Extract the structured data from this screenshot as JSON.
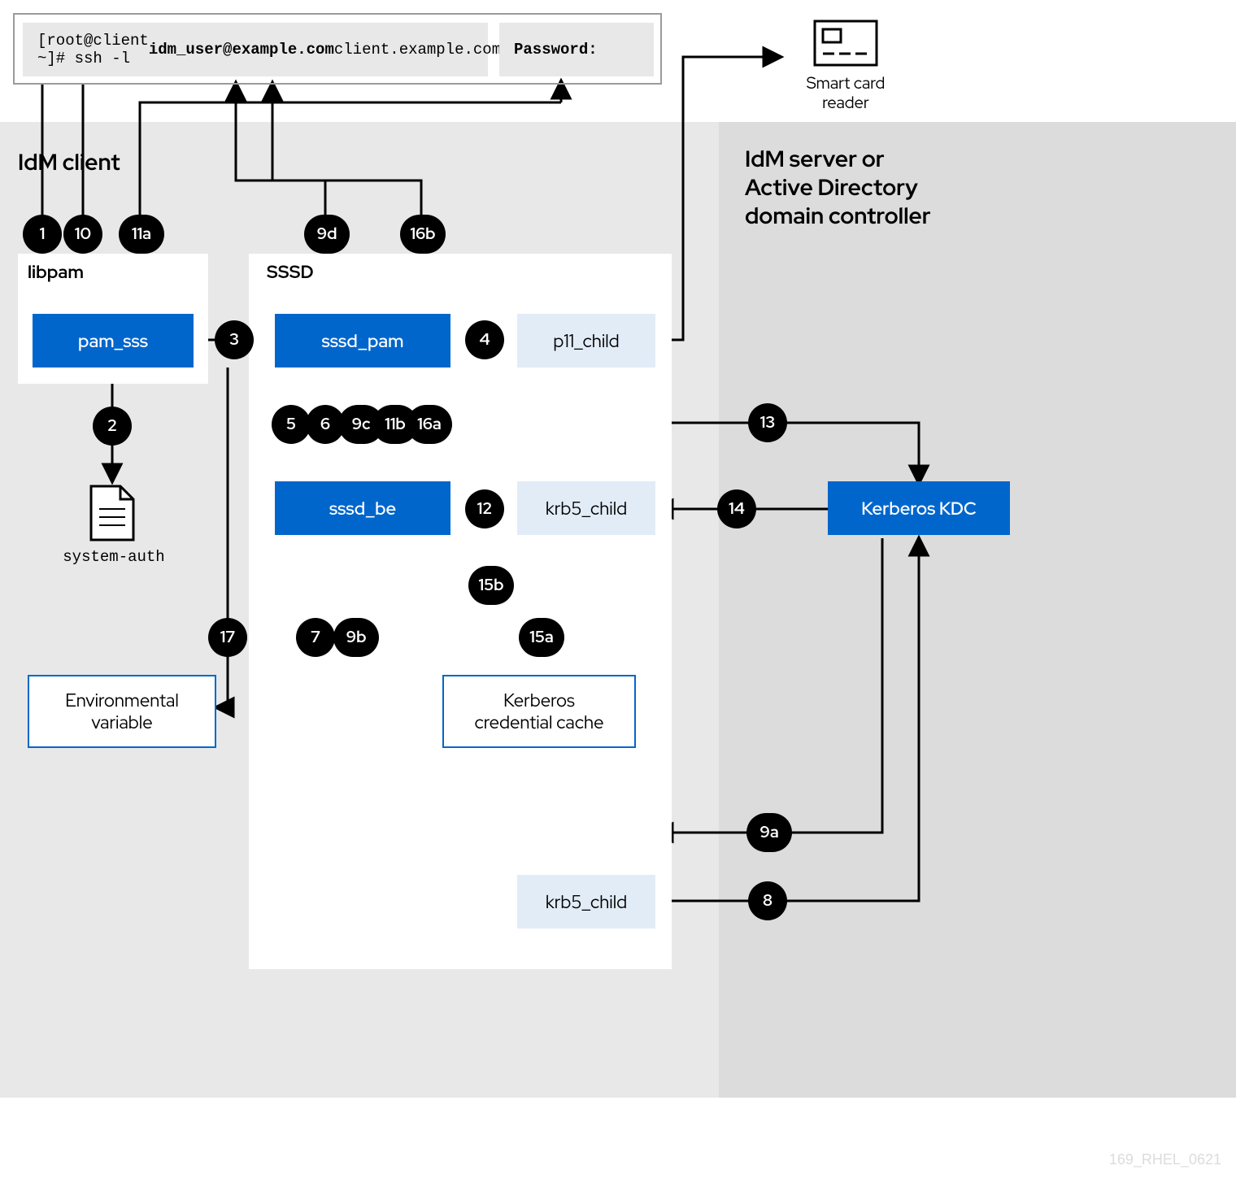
{
  "terminal": {
    "prompt": "[root@client ~]# ssh -l ",
    "bold": "idm_user@example.com",
    "rest": " client.example.com",
    "password_prompt": "Password:"
  },
  "smartcard": {
    "label": "Smart card\nreader"
  },
  "headings": {
    "idm_client": "IdM client",
    "idm_server": "IdM server or\nActive Directory\ndomain controller",
    "libpam": "libpam",
    "sssd": "SSSD"
  },
  "boxes": {
    "pam_sss": "pam_sss",
    "sssd_pam": "sssd_pam",
    "p11_child": "p11_child",
    "sssd_be": "sssd_be",
    "krb5_child_top": "krb5_child",
    "krb5_child_bottom": "krb5_child",
    "kerberos_kdc": "Kerberos KDC",
    "env_var": "Environmental\nvariable",
    "kerberos_cc": "Kerberos\ncredential cache",
    "system_auth": "system-auth"
  },
  "badges": {
    "n1": "1",
    "n10": "10",
    "n11a": "11a",
    "n9d": "9d",
    "n16b": "16b",
    "n3": "3",
    "n4": "4",
    "n2": "2",
    "n5": "5",
    "n6": "6",
    "n9c": "9c",
    "n11b": "11b",
    "n16a": "16a",
    "n12": "12",
    "n13": "13",
    "n14": "14",
    "n7": "7",
    "n9b": "9b",
    "n15a": "15a",
    "n15b": "15b",
    "n17": "17",
    "n8": "8",
    "n9a": "9a"
  },
  "watermark": "169_RHEL_0621"
}
